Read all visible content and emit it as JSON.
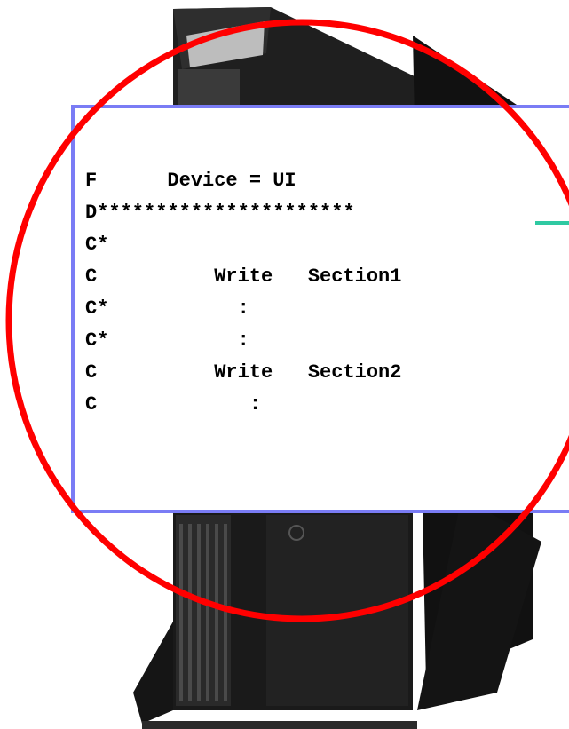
{
  "code": {
    "lines": [
      "F      Device = UI",
      "D**********************",
      "C*",
      "C          Write   Section1",
      "C*           :",
      "C*           :",
      "C          Write   Section2",
      "C             :"
    ]
  },
  "colors": {
    "panel_border": "#7a7cf5",
    "highlight_circle": "#ff0000",
    "accent_line": "#2fc9a2",
    "text": "#000000"
  }
}
